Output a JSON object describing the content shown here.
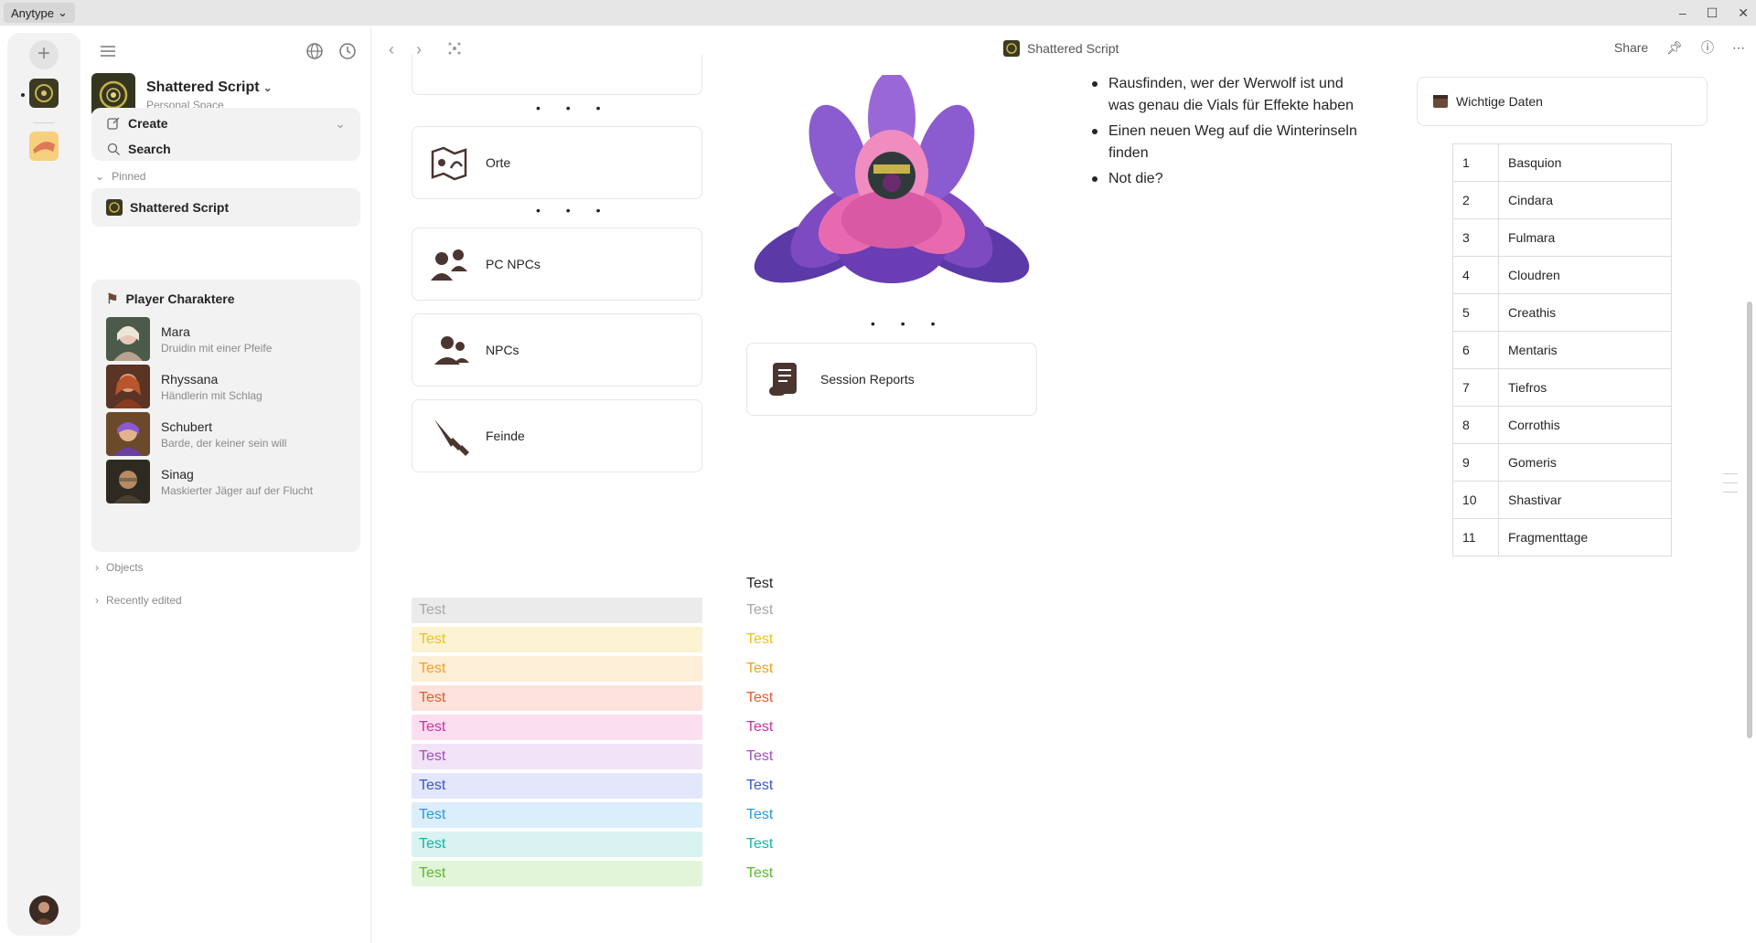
{
  "titlebar": {
    "app_name": "Anytype",
    "minimize": "–",
    "maximize": "☐",
    "close": "✕"
  },
  "sidebar": {
    "space_name": "Shattered Script",
    "space_type": "Personal Space",
    "create_label": "Create",
    "search_label": "Search",
    "pinned_label": "Pinned",
    "pinned_items": [
      "Shattered Script"
    ],
    "widget_title": "Player Charaktere",
    "people": [
      {
        "name": "Mara",
        "desc": "Druidin mit einer Pfeife"
      },
      {
        "name": "Rhyssana",
        "desc": "Händlerin mit Schlag"
      },
      {
        "name": "Schubert",
        "desc": "Barde, der keiner sein will"
      },
      {
        "name": "Sinag",
        "desc": "Maskierter Jäger auf der Flucht"
      }
    ],
    "objects_label": "Objects",
    "recent_label": "Recently edited"
  },
  "header": {
    "title": "Shattered Script",
    "share_label": "Share"
  },
  "content": {
    "cards": {
      "orte": "Orte",
      "pc_npcs": "PC NPCs",
      "npcs": "NPCs",
      "feinde": "Feinde",
      "session_reports": "Session Reports"
    },
    "dots": "• • •",
    "bullets": [
      "Rausfinden, wer der Werwolf ist und was genau die Vials für Effekte haben",
      "Einen neuen Weg auf die Winterinseln finden",
      "Not die?"
    ],
    "dates_title": "Wichtige Daten",
    "dates": [
      {
        "n": "1",
        "name": "Basquion"
      },
      {
        "n": "2",
        "name": "Cindara"
      },
      {
        "n": "3",
        "name": "Fulmara"
      },
      {
        "n": "4",
        "name": "Cloudren"
      },
      {
        "n": "5",
        "name": "Creathis"
      },
      {
        "n": "6",
        "name": "Mentaris"
      },
      {
        "n": "7",
        "name": "Tiefros"
      },
      {
        "n": "8",
        "name": "Corrothis"
      },
      {
        "n": "9",
        "name": "Gomeris"
      },
      {
        "n": "10",
        "name": "Shastivar"
      },
      {
        "n": "11",
        "name": "Fragmenttage"
      }
    ],
    "test_label": "Test",
    "color_rows": [
      {
        "bg": "#ebebeb",
        "fg": "#a8a8a8"
      },
      {
        "bg": "#fcf3d2",
        "fg": "#ecc31c"
      },
      {
        "bg": "#fdeed7",
        "fg": "#f0a21e"
      },
      {
        "bg": "#fde3dc",
        "fg": "#e55a2b"
      },
      {
        "bg": "#fbdff1",
        "fg": "#d1309e"
      },
      {
        "bg": "#f2e3f6",
        "fg": "#9f4fba"
      },
      {
        "bg": "#e3e7fb",
        "fg": "#3a56c9"
      },
      {
        "bg": "#dbeefb",
        "fg": "#2a9ad8"
      },
      {
        "bg": "#d9f3f1",
        "fg": "#19b2a6"
      },
      {
        "bg": "#e2f5d9",
        "fg": "#5cb82a"
      }
    ]
  }
}
